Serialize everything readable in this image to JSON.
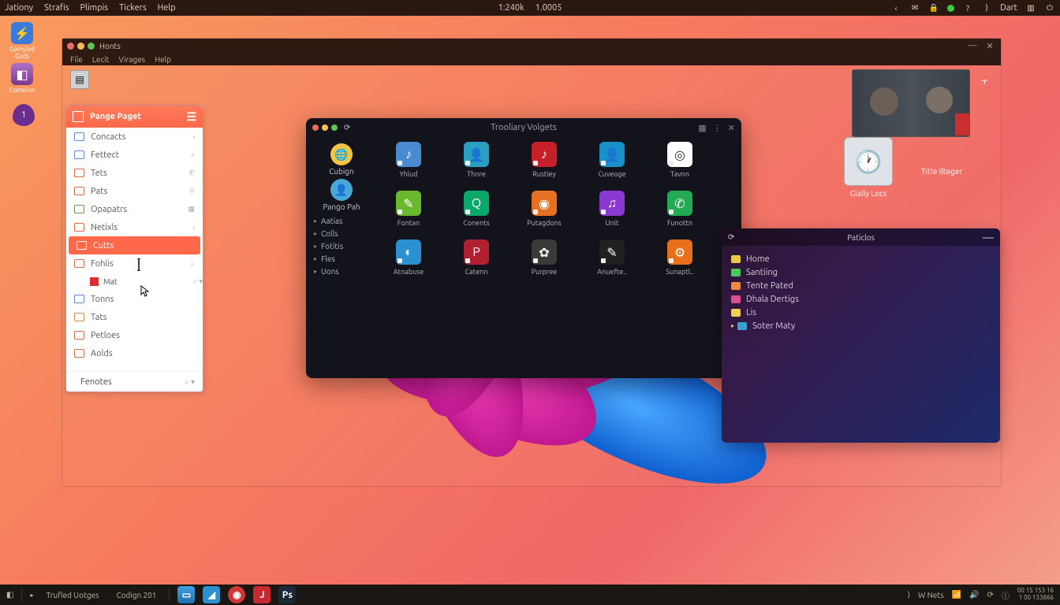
{
  "topbar": {
    "menus": [
      "Jationy",
      "Strafis",
      "Plimpis",
      "Tickers",
      "Help"
    ],
    "center": [
      "1:240k",
      "1.0005"
    ],
    "right_label": "Dart"
  },
  "desktop_icons": [
    {
      "label": "Gomyled Gads",
      "color": "#3a7ad8",
      "glyph": "⚡"
    },
    {
      "label": "Comelies",
      "color": "#7a3a8a",
      "glyph": "◧"
    },
    {
      "label": "",
      "color": "#6a2d8f",
      "glyph": "🛡",
      "badge": "1"
    }
  ],
  "home_window": {
    "title": "Honts",
    "menu": [
      "File",
      "Lecit",
      "Virages",
      "Help"
    ]
  },
  "panel": {
    "title": "Pange Paget",
    "items": [
      {
        "label": "Concacts",
        "right": "chev"
      },
      {
        "label": "Fettect",
        "right": "search"
      },
      {
        "label": "Tets",
        "right": "phone"
      },
      {
        "label": "Pats",
        "right": "link"
      },
      {
        "label": "Opapatrs",
        "right": "cal"
      },
      {
        "label": "Netixls",
        "right": "chev"
      },
      {
        "label": "Cutts",
        "selected": true
      },
      {
        "label": "Fohlis",
        "right": "ring"
      },
      {
        "label": "Tonns"
      },
      {
        "label": "Tats"
      },
      {
        "label": "Petloes"
      },
      {
        "label": "Aolds"
      }
    ],
    "sub": {
      "label": "Mat"
    },
    "footer": {
      "label": "Fenotes"
    }
  },
  "dark_window": {
    "title": "Trooliary Volgets",
    "side_icons": [
      {
        "label": "Cubign",
        "color": "#f5c542"
      },
      {
        "label": "Pango Pah",
        "color": "#4aa8d8"
      }
    ],
    "side_items": [
      "Aatias",
      "Colls",
      "Fotitis",
      "Fles",
      "Uons"
    ],
    "apps": [
      [
        {
          "label": "Yhlud",
          "color": "#4a8ad0",
          "glyph": "♪"
        },
        {
          "label": "Thnre",
          "color": "#2aa0c0",
          "glyph": "👤"
        },
        {
          "label": "Rustiey",
          "color": "#c8202a",
          "glyph": "♪"
        },
        {
          "label": "Cuveoge",
          "color": "#1a90c8",
          "glyph": "👤"
        },
        {
          "label": "Tavnn",
          "color": "#ffffff",
          "glyph": "◎"
        }
      ],
      [
        {
          "label": "Fontan",
          "color": "#6ab82e",
          "glyph": "✎"
        },
        {
          "label": "Conents",
          "color": "#0aa86a",
          "glyph": "Q"
        },
        {
          "label": "Putagdons",
          "color": "#e87022",
          "glyph": "◉"
        },
        {
          "label": "Unit",
          "color": "#8a3ad0",
          "glyph": "♫"
        },
        {
          "label": "Funottn",
          "color": "#22aa55",
          "glyph": "✆"
        }
      ],
      [
        {
          "label": "Atnabuse",
          "color": "#2a90d0",
          "glyph": "◐"
        },
        {
          "label": "Catenn",
          "color": "#b02030",
          "glyph": "P"
        },
        {
          "label": "Purpree",
          "color": "#3a3a3a",
          "glyph": "✿"
        },
        {
          "label": "Anuefte..",
          "color": "#202020",
          "glyph": "✎"
        },
        {
          "label": "Sunaptl..",
          "color": "#e8701a",
          "glyph": "⚙"
        }
      ]
    ]
  },
  "particles": {
    "title": "Paticlos",
    "items": [
      {
        "label": "Home",
        "color": "#f0c840"
      },
      {
        "label": "Santiing",
        "color": "#4ac85a"
      },
      {
        "label": "Tente Pated",
        "color": "#f08840"
      },
      {
        "label": "Dhala Dertigs",
        "color": "#d85090"
      },
      {
        "label": "Lis",
        "color": "#f0d050"
      },
      {
        "label": "Soter Maty",
        "color": "#3aa0d0",
        "arrow": true
      }
    ]
  },
  "thumbs": {
    "clock": {
      "label": "Gially Locs"
    },
    "video": {
      "label": "Title Ilteger"
    }
  },
  "taskbar": {
    "left": [
      "Trufled Uotges",
      "Codign 201"
    ],
    "right_label": "W Nets",
    "clock": [
      "00 15 153 16",
      "1 00 133866"
    ]
  }
}
